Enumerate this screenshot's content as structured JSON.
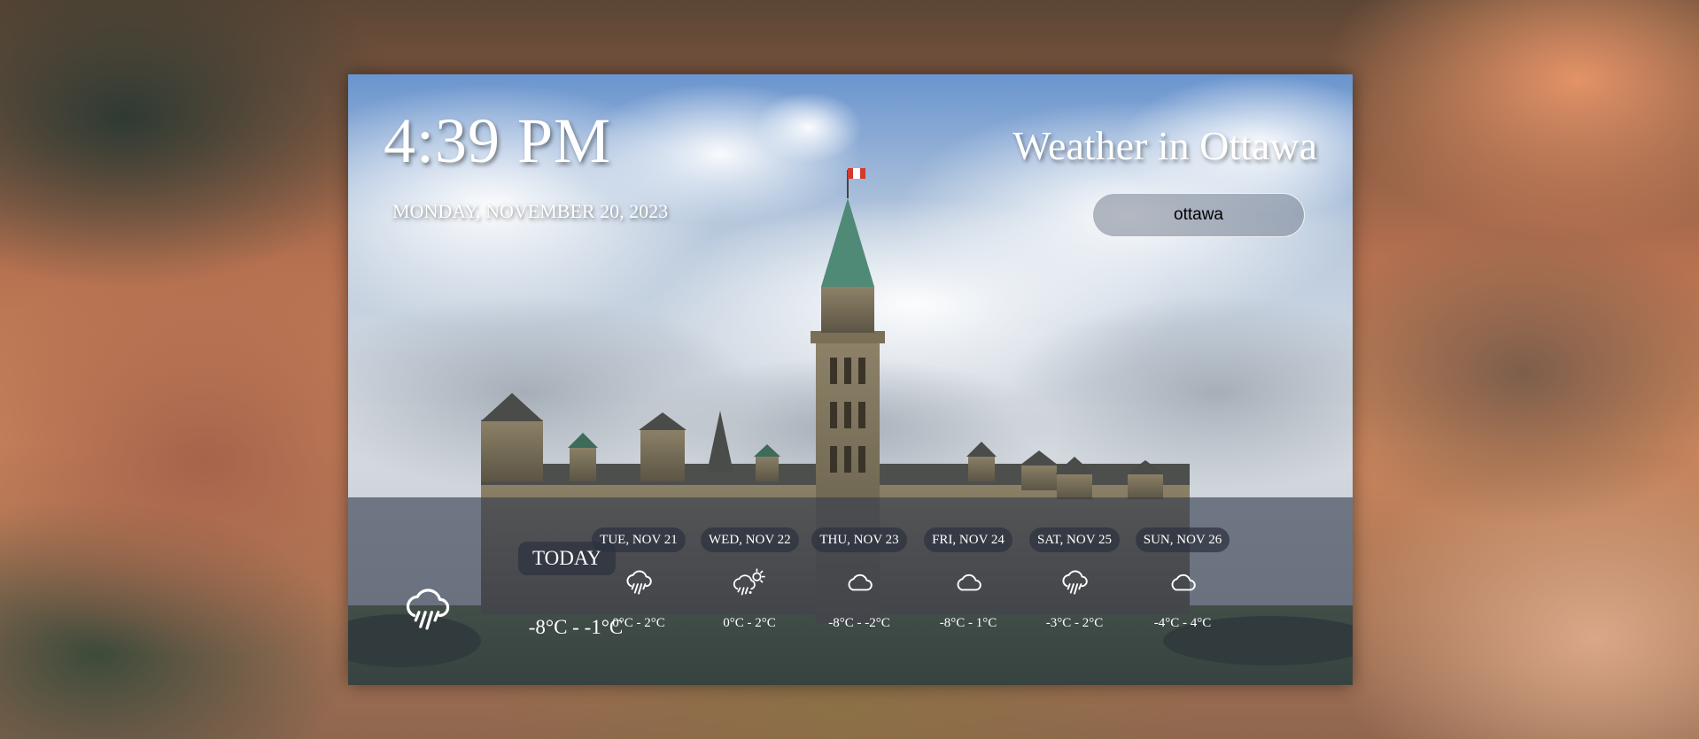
{
  "header": {
    "time": "4:39 PM",
    "date": "MONDAY, NOVEMBER 20, 2023",
    "title": "Weather in Ottawa"
  },
  "search": {
    "value": "ottawa"
  },
  "today": {
    "label": "TODAY",
    "icon": "rain-cloud-icon",
    "temp": "-8°C - -1°C"
  },
  "forecast": [
    {
      "label": "TUE, NOV 21",
      "icon": "rain-cloud-icon",
      "temp": "0°C - 2°C"
    },
    {
      "label": "WED, NOV 22",
      "icon": "sun-rain-cloud-icon",
      "temp": "0°C - 2°C"
    },
    {
      "label": "THU, NOV 23",
      "icon": "cloud-icon",
      "temp": "-8°C - -2°C"
    },
    {
      "label": "FRI, NOV 24",
      "icon": "cloud-icon",
      "temp": "-8°C - 1°C"
    },
    {
      "label": "SAT, NOV 25",
      "icon": "rain-cloud-icon",
      "temp": "-3°C - 2°C"
    },
    {
      "label": "SUN, NOV 26",
      "icon": "cloud-icon",
      "temp": "-4°C - 4°C"
    }
  ]
}
